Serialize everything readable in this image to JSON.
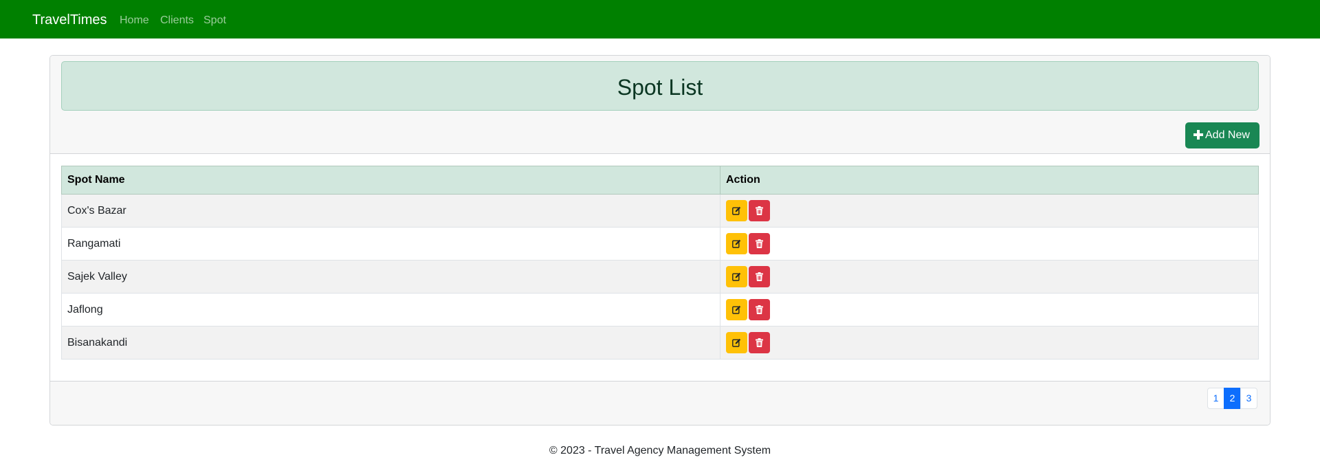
{
  "navbar": {
    "brand": "TravelTimes",
    "links": [
      "Home",
      "Clients",
      "Spot"
    ],
    "bg_color": "#008000"
  },
  "page": {
    "title": "Spot List",
    "add_button": {
      "icon": "plus-icon",
      "label": "Add New"
    }
  },
  "table": {
    "headers": [
      "Spot Name",
      "Action"
    ],
    "rows": [
      {
        "name": "Cox's Bazar"
      },
      {
        "name": "Rangamati"
      },
      {
        "name": "Sajek Valley"
      },
      {
        "name": "Jaflong"
      },
      {
        "name": "Bisanakandi"
      }
    ],
    "actions": {
      "edit_icon": "edit-icon",
      "delete_icon": "trash-icon",
      "edit_color": "#ffc107",
      "delete_color": "#dc3545"
    }
  },
  "pagination": {
    "pages": [
      "1",
      "2",
      "3"
    ],
    "active": "2"
  },
  "footer": {
    "text": "© 2023 - Travel Agency Management System"
  }
}
